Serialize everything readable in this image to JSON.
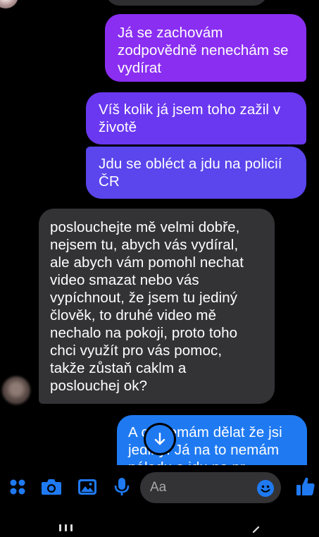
{
  "chat": {
    "messages": [
      {
        "direction": "out",
        "text": "Já se zachovám\nzodpovědně nenechám se\nvydírat"
      },
      {
        "direction": "out",
        "text": "Víš kolik já jsem toho zažil v\nživotě"
      },
      {
        "direction": "out",
        "text": "Jdu se obléct a jdu na policií\nČR"
      },
      {
        "direction": "in",
        "text": "poslouchejte mě velmi dobře,\nnejsem tu, abych vás vydíral,\nale abych vám pomohl nechat\nvideo smazat nebo vás\nvypíchnout, že jsem tu jediný\nčlověk, to druhé video mě\nnechalo na pokoji, proto toho\nchci využít pro vás pomoc,\ntakže zůstaň caklm a\nposlouchej ok?"
      },
      {
        "direction": "out",
        "text": "A co nemám dělat že jsi\njediný. Já na to nemám\nnáladu a jdu na pr..."
      }
    ]
  },
  "composer": {
    "placeholder": "Aa",
    "icons": [
      "menu-dots-icon",
      "camera-icon",
      "gallery-icon",
      "microphone-icon",
      "emoji-icon",
      "thumbs-up-icon"
    ]
  },
  "colors": {
    "background": "#000000",
    "incoming_bubble": "#333336",
    "outgoing_gradient": [
      "#8a2ef2",
      "#6a38f0",
      "#5a46ec",
      "#1f7af2"
    ],
    "accent": "#1f7af2"
  }
}
